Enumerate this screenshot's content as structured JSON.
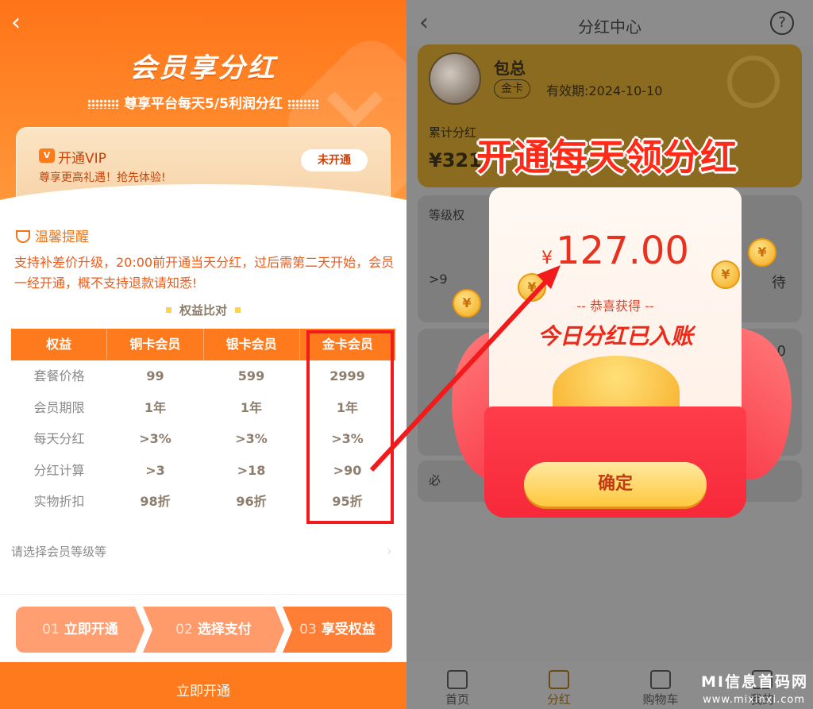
{
  "left": {
    "hero_title": "会员享分红",
    "hero_subtitle": "尊享平台每天5/5利润分红",
    "vip": {
      "badge": "V",
      "title": "开通VIP",
      "desc": "尊享更高礼遇！抢先体验!",
      "status_button": "未开通"
    },
    "tip": {
      "heading": "温馨提醒",
      "text": "支持补差价升级，20:00前开通当天分红，过后需第二天开始，会员一经开通，概不支持退款请知悉!"
    },
    "compare_title": "权益比对",
    "table": {
      "headers": [
        "权益",
        "铜卡会员",
        "银卡会员",
        "金卡会员"
      ],
      "rows": [
        [
          "套餐价格",
          "99",
          "599",
          "2999"
        ],
        [
          "会员期限",
          "1年",
          "1年",
          "1年"
        ],
        [
          "每天分红",
          ">3%",
          ">3%",
          ">3%"
        ],
        [
          "分红计算",
          ">3",
          ">18",
          ">90"
        ],
        [
          "实物折扣",
          "98折",
          "96折",
          "95折"
        ]
      ]
    },
    "select_level": "请选择会员等级等",
    "steps": [
      {
        "num": "01",
        "label": "立即开通"
      },
      {
        "num": "02",
        "label": "选择支付"
      },
      {
        "num": "03",
        "label": "享受权益"
      }
    ],
    "open_button": "立即开通"
  },
  "right": {
    "title": "分红中心",
    "help": "?",
    "user": {
      "name": "包总",
      "badge": "金卡",
      "expiry": "有效期:2024-10-10",
      "accum_label": "累计分红",
      "accum_value": "¥321"
    },
    "card1_label": "等级权",
    "card1_frag_left": ">9",
    "card1_frag_right": "待",
    "card2_frag": "0.0",
    "card3_label": "必",
    "headline": "开通每天领分红",
    "popup": {
      "currency": "¥",
      "amount": "127.00",
      "sub": "-- 恭喜获得 --",
      "main": "今日分红已入账",
      "coin_symbol": "¥",
      "confirm": "确定"
    },
    "tabs": [
      "首页",
      "分红",
      "购物车",
      "我的"
    ]
  },
  "watermark": {
    "main": "MI信息首码网",
    "sub": "www.mixinxi.com"
  },
  "colors": {
    "orange": "#ff7a1c",
    "red_highlight": "#f21a1a",
    "popup_red": "#e8311f"
  }
}
